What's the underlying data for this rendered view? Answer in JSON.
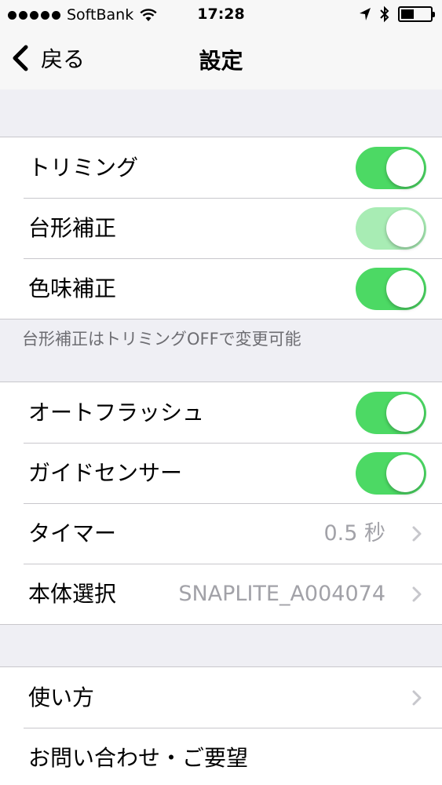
{
  "status_bar": {
    "carrier": "SoftBank",
    "time": "17:28"
  },
  "nav": {
    "back_label": "戻る",
    "title": "設定"
  },
  "group1": {
    "trimming": {
      "label": "トリミング",
      "on": true
    },
    "keystone": {
      "label": "台形補正",
      "on": true,
      "disabled": true
    },
    "color": {
      "label": "色味補正",
      "on": true
    },
    "footer": "台形補正はトリミングOFFで変更可能"
  },
  "group2": {
    "autoflash": {
      "label": "オートフラッシュ",
      "on": true
    },
    "guide": {
      "label": "ガイドセンサー",
      "on": true
    },
    "timer": {
      "label": "タイマー",
      "value": "0.5 秒"
    },
    "device": {
      "label": "本体選択",
      "value": "SNAPLITE_A004074"
    }
  },
  "group3": {
    "howto": {
      "label": "使い方"
    },
    "contact": {
      "label": "お問い合わせ・ご要望"
    }
  },
  "colors": {
    "toggle_on": "#4cd964",
    "toggle_disabled": "#a8ecb4",
    "background": "#efeff4",
    "value_gray": "#a2a2a8"
  },
  "icons": [
    "wifi-icon",
    "location-arrow-icon",
    "bluetooth-icon",
    "battery-icon",
    "back-chevron-icon",
    "disclosure-chevron-icon"
  ]
}
